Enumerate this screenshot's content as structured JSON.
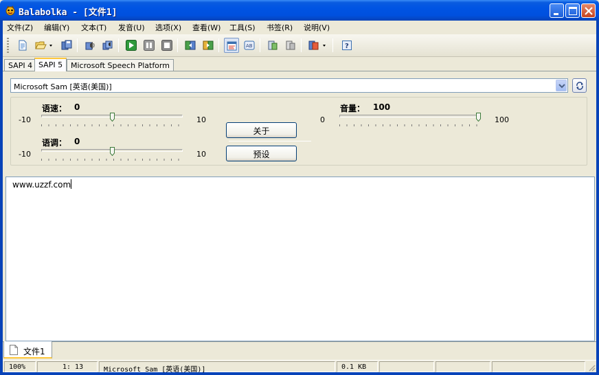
{
  "window": {
    "title": "Balabolka - [文件1]"
  },
  "menu": [
    "文件(Z)",
    "编辑(Y)",
    "文本(T)",
    "发音(U)",
    "选项(X)",
    "查看(W)",
    "工具(S)",
    "书签(R)",
    "说明(V)"
  ],
  "toolbar": {
    "icons": [
      "new-document-icon",
      "open-folder-icon",
      "save-icon",
      "save-audio-icon",
      "batch-convert-icon",
      "play-icon",
      "pause-icon",
      "stop-icon",
      "previous-icon",
      "next-icon",
      "settings-icon",
      "voice-icon",
      "clipboard-read-icon",
      "clipboard-watch-icon",
      "export-icon",
      "help-icon"
    ]
  },
  "tabs": [
    "SAPI 4",
    "SAPI 5",
    "Microsoft Speech Platform"
  ],
  "active_tab": "SAPI 5",
  "voice": {
    "selected": "Microsoft Sam [英语(美国)]"
  },
  "rate": {
    "label": "语速：",
    "value": "0",
    "min_label": "-10",
    "max_label": "10",
    "fraction": 0.5
  },
  "pitch": {
    "label": "语调：",
    "value": "0",
    "min_label": "-10",
    "max_label": "10",
    "fraction": 0.5
  },
  "volume": {
    "label": "音量：",
    "value": "100",
    "min_label": "0",
    "max_label": "100",
    "fraction": 1.0
  },
  "buttons": {
    "about": "关于",
    "preset": "预设"
  },
  "editor": {
    "text": "www.uzzf.com"
  },
  "document_tab": "文件1",
  "status": {
    "zoom": "100%",
    "position": "1:  13",
    "voice": "Microsoft Sam [英语(美国)]",
    "size": "0.1 KB"
  },
  "colors": {
    "titlebar": "#0054e3",
    "tab_highlight": "#ffc83c",
    "field_border": "#7f9db9"
  }
}
